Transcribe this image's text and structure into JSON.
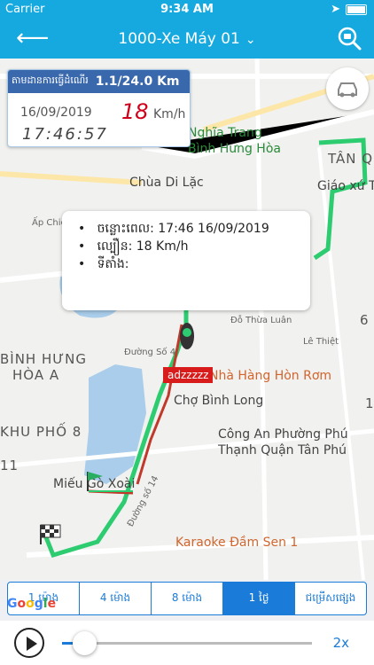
{
  "status": {
    "carrier": "Carrier",
    "time": "9:34 AM"
  },
  "nav": {
    "title": "1000-Xe Máy 01"
  },
  "info_card": {
    "label": "តាមដានការធ្វើដំណើរ",
    "distance": "1.1/24.0 Km",
    "date": "16/09/2019",
    "speed": "18",
    "speed_unit": "Km/h",
    "clock": "17:46:57"
  },
  "popup": {
    "time_row": "ចន្លោះពេល: 17:46 16/09/2019",
    "speed_row": "ល្បឿន: 18 Km/h",
    "location_row": "ទីតាំង:"
  },
  "vehicle_tag": "adzzzzz",
  "map_labels": {
    "nghia_trang": "Nghĩa Trang",
    "binh_hung_hoa": "Bình Hưng Hòa",
    "chua_di_lac": "Chùa Di Lặc",
    "giao_xu": "Giáo xứ Tân",
    "tan_qu": "TÂN QU",
    "ap_chien": "Ấp Chiến",
    "binh_hung_district_1": "BÌNH HƯNG",
    "binh_hung_district_2": "HÒA A",
    "khu_pho": "KHU PHỐ 8",
    "nha_hang": "Nhà Hàng Hòn Rơm",
    "cho_binh_long": "Chợ Bình Long",
    "cong_an_1": "Công An Phường Phú",
    "cong_an_2": "Thạnh Quận Tân Phú",
    "mieu": "Miếu Gò Xoài",
    "karaoke": "Karaoke Đầm Sen 1",
    "le_thiet": "Lê Thiệt",
    "do_thua_luan": "Đỗ Thừa Luân",
    "duong_so_4": "Đường Số 4",
    "duong_so_14": "Đường số 14",
    "num_11": "11",
    "num_6": "6",
    "num_1": "1"
  },
  "tabs": [
    "1 ម៉ោង",
    "4 ម៉ោង",
    "8 ម៉ោង",
    "1 ថ្ងៃ",
    "ជម្រើសផ្សេង"
  ],
  "active_tab": 3,
  "google": [
    "G",
    "o",
    "o",
    "g",
    "l",
    "e"
  ],
  "player": {
    "rate": "2x",
    "progress": 0.05
  },
  "colors": {
    "header": "#15a9df",
    "accent": "#1a7bd8",
    "route_green": "#2ecc71",
    "route_red": "#c0392b",
    "speed_red": "#d0021b"
  }
}
